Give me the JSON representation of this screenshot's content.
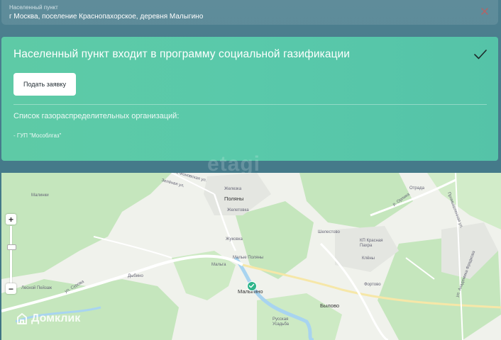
{
  "address_field": {
    "label": "Населенный пункт",
    "value": "г Москва, поселение Краснопахорское, деревня Малыгино"
  },
  "gas_card": {
    "title": "Населенный пункт входит в программу социальной газификации",
    "apply_button": "Подать заявку",
    "orgs_title": "Список газораспределительных организаций:",
    "orgs": [
      "- ГУП \"Мособлгаз\""
    ]
  },
  "map": {
    "zoom_in": "+",
    "zoom_out": "−",
    "labels": {
      "polyany": "Поляны",
      "zhelezka": "Железка",
      "zhelezka2": "Желетовка",
      "zhukovka": "Жуковка",
      "malye_polyany": "Малые Поляны",
      "malga": "Мальга",
      "malygino": "Малыгино",
      "dybino": "Дыбино",
      "lesnoy": "Лесной Пейзаж",
      "sirova": "ул. Сурова",
      "shelestovo": "Шелестово",
      "kp_krasnaya": "КП Красная Пахра",
      "klenovo": "Клёны",
      "fortovo": "Фортово",
      "bylovo": "Былово",
      "russkaya": "Русская Усадьба",
      "orlova": "р. Орлика",
      "promyshlennaya": "Промышленная ул.",
      "akademika": "ул. Академика Фрадкова",
      "zelenaya": "Зелёная ул.",
      "fonovskaya": "2-я Фоновская ул.",
      "malinki": "Малинки",
      "otrada": "Отрада"
    }
  },
  "brand": {
    "name": "Домклик"
  },
  "watermark": "etagi",
  "colors": {
    "accent": "#5ecaa6",
    "background": "#477b8b",
    "marker": "#2fb58b",
    "clear_icon": "#d9534f"
  }
}
